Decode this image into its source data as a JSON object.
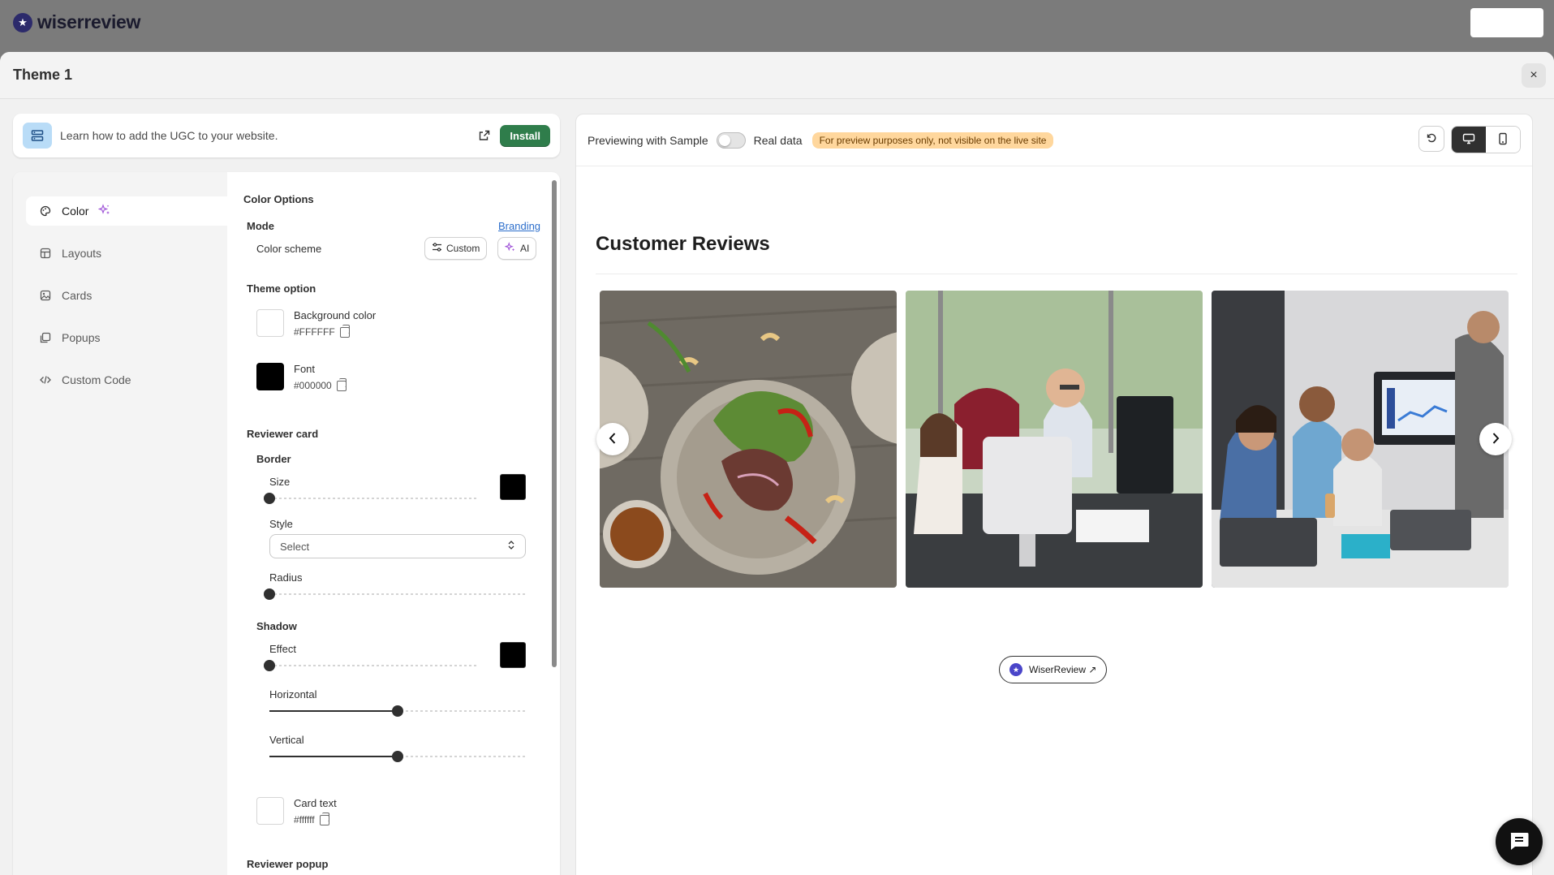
{
  "app": {
    "brand_name": "wiserreview"
  },
  "modal": {
    "title": "Theme 1",
    "close_label": "×"
  },
  "learn": {
    "text": "Learn how to add the UGC to your website.",
    "install_label": "Install"
  },
  "nav": {
    "items": [
      {
        "label": "Color",
        "icon": "palette-icon",
        "active": true
      },
      {
        "label": "Layouts",
        "icon": "layout-icon"
      },
      {
        "label": "Cards",
        "icon": "cards-icon"
      },
      {
        "label": "Popups",
        "icon": "popup-icon"
      },
      {
        "label": "Custom Code",
        "icon": "code-icon"
      }
    ]
  },
  "panel": {
    "section_title": "Color Options",
    "mode_label": "Mode",
    "branding_link": "Branding",
    "color_scheme_label": "Color scheme",
    "custom_btn": "Custom",
    "ai_btn": "AI",
    "theme_option_label": "Theme option",
    "background_color": {
      "label": "Background color",
      "hex": "#FFFFFF"
    },
    "font_color": {
      "label": "Font",
      "hex": "#000000"
    },
    "reviewer_card_label": "Reviewer card",
    "border_label": "Border",
    "size_label": "Size",
    "size_value": 0,
    "border_color": "#000000",
    "style_label": "Style",
    "style_select": "Select",
    "radius_label": "Radius",
    "radius_value": 0,
    "shadow_label": "Shadow",
    "effect_label": "Effect",
    "effect_value": 0,
    "shadow_color": "#000000",
    "horizontal_label": "Horizontal",
    "horizontal_value": 0.5,
    "vertical_label": "Vertical",
    "vertical_value": 0.5,
    "card_text": {
      "label": "Card text",
      "hex": "#ffffff"
    },
    "reviewer_popup_label": "Reviewer popup"
  },
  "preview": {
    "sample_label": "Previewing with Sample",
    "real_data_label": "Real data",
    "badge_text": "For preview purposes only, not visible on the live site",
    "title": "Customer Reviews",
    "photos": [
      {
        "name": "food-bowl-photo"
      },
      {
        "name": "office-computer-photo"
      },
      {
        "name": "meeting-presentation-photo"
      }
    ],
    "powered_label": "WiserReview ↗"
  },
  "colors": {
    "install_green": "#2f7d4b",
    "badge_orange": "#ffd79d",
    "link_blue": "#2c6ecb",
    "ai_purple": "#a259d9"
  }
}
